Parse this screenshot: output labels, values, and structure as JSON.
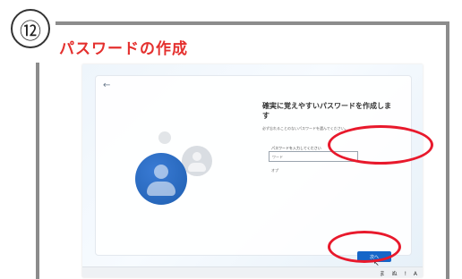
{
  "step": {
    "number": "⑫",
    "title": "パスワードの作成"
  },
  "screen": {
    "back_glyph": "←",
    "heading": "確実に覚えやすいパスワードを作成します",
    "subtext": "必ず忘れることのないパスワードを選んでください。",
    "field_label": "パスワードを入力してください",
    "input_value": "",
    "input_placeholder": "ワード",
    "option_text": "オプ",
    "next_label": "次へ",
    "cursor_glyph": "↖"
  },
  "taskbar": {
    "tray": [
      "ま",
      "ぬ",
      "!",
      "A"
    ]
  },
  "colors": {
    "title": "#e4302e",
    "highlight": "#e8192c",
    "button": "#1666c8",
    "frame": "#8c8c8c"
  }
}
